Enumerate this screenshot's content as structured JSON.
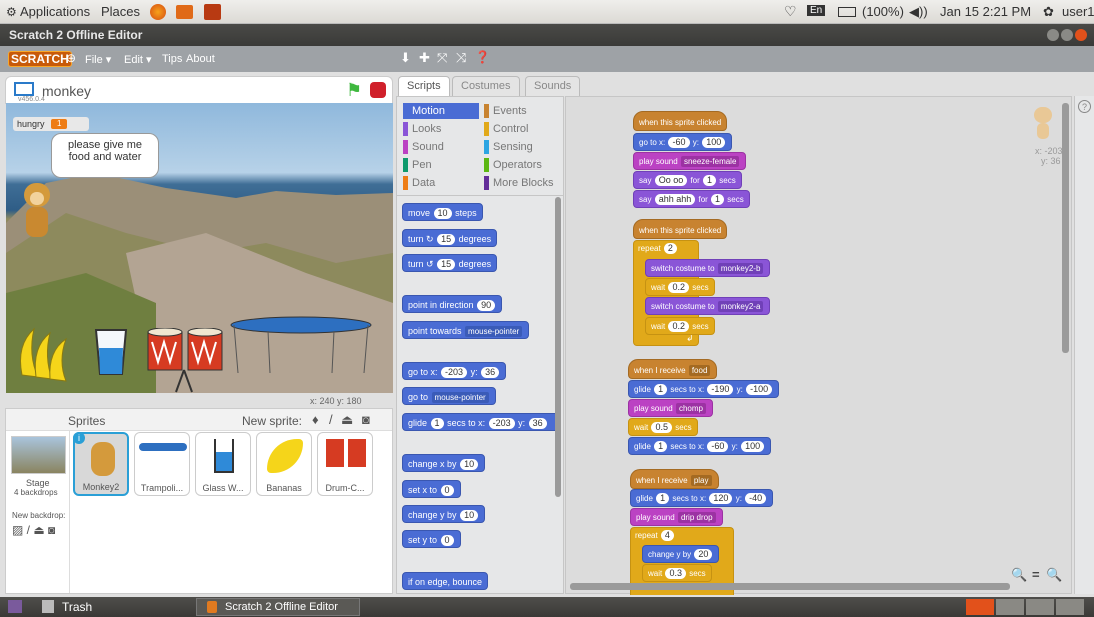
{
  "topbar": {
    "applications": "Applications",
    "places": "Places",
    "lang": "En",
    "battery": "(100%)",
    "datetime": "Jan 15  2:21 PM",
    "user": "user1"
  },
  "window": {
    "title": "Scratch 2 Offline Editor"
  },
  "menu": {
    "logo": "SCRATCH",
    "file": "File ▾",
    "edit": "Edit ▾",
    "tips": "Tips",
    "about": "About"
  },
  "stage": {
    "sprite_name": "monkey",
    "version": "v456.0.4",
    "var_name": "hungry",
    "var_value": "1",
    "speech": "please give me food and water",
    "coords_x": "x: 240",
    "coords_y": "y: 180"
  },
  "sprites": {
    "title": "Sprites",
    "new_sprite": "New sprite:",
    "stage_label": "Stage",
    "stage_sub": "4 backdrops",
    "new_backdrop": "New backdrop:",
    "items": [
      {
        "label": "Monkey2"
      },
      {
        "label": "Trampoli..."
      },
      {
        "label": "Glass W..."
      },
      {
        "label": "Bananas"
      },
      {
        "label": "Drum-C..."
      }
    ]
  },
  "tabs": {
    "scripts": "Scripts",
    "costumes": "Costumes",
    "sounds": "Sounds"
  },
  "categories": {
    "motion": "Motion",
    "events": "Events",
    "looks": "Looks",
    "control": "Control",
    "sound": "Sound",
    "sensing": "Sensing",
    "pen": "Pen",
    "operators": "Operators",
    "data": "Data",
    "more": "More Blocks"
  },
  "palette": {
    "move": "move",
    "move_n": "10",
    "steps": "steps",
    "turn": "turn",
    "turn_n": "15",
    "degrees": "degrees",
    "pid": "point in direction",
    "pid_n": "90",
    "pt": "point towards",
    "pt_v": "mouse-pointer",
    "goto": "go to x:",
    "goto_x": "-203",
    "y": "y:",
    "goto_y": "36",
    "goto2": "go to",
    "goto2_v": "mouse-pointer",
    "glide": "glide",
    "glide_n": "1",
    "secs_to": "secs to x:",
    "glide_x": "-203",
    "glide_y": "36",
    "cx": "change x by",
    "cx_n": "10",
    "sx": "set x to",
    "sx_n": "0",
    "cy": "change y by",
    "cy_n": "10",
    "sy": "set y to",
    "sy_n": "0",
    "bounce": "if on edge, bounce"
  },
  "scripts": {
    "s1_hat": "when this sprite clicked",
    "goto": "go to x:",
    "s1_x": "-60",
    "y": "y:",
    "s1_y": "100",
    "play": "play sound",
    "s1_snd": "sneeze-female",
    "say": "say",
    "s1_say1": "Oo oo",
    "for": "for",
    "secs": "secs",
    "s1_n1": "1",
    "s1_say2": "ahh ahh",
    "s1_n2": "1",
    "s2_hat": "when this sprite clicked",
    "repeat": "repeat",
    "s2_n": "2",
    "switch": "switch costume to",
    "c1": "monkey2-b",
    "wait": "wait",
    "w1": "0.2",
    "c2": "monkey2-a",
    "w2": "0.2",
    "s3_hat": "when I receive",
    "s3_msg": "food",
    "glide": "glide",
    "secs_to": "secs to x:",
    "s3_g1": "1",
    "s3_x1": "-190",
    "s3_y1": "-100",
    "s3_snd": "chomp",
    "s3_w": "0.5",
    "s3_g2": "1",
    "s3_x2": "-60",
    "s3_y2": "100",
    "s4_msg": "play",
    "s4_g": "1",
    "s4_x": "120",
    "s4_y": "-40",
    "s4_snd": "drip drop",
    "s4_n": "4",
    "cy": "change y by",
    "s4_cy": "20",
    "s4_w": "0.3"
  },
  "sprite_info": {
    "x": "x: -203",
    "y": "y: 36"
  },
  "taskbar": {
    "trash": "Trash",
    "app": "Scratch 2 Offline Editor"
  }
}
